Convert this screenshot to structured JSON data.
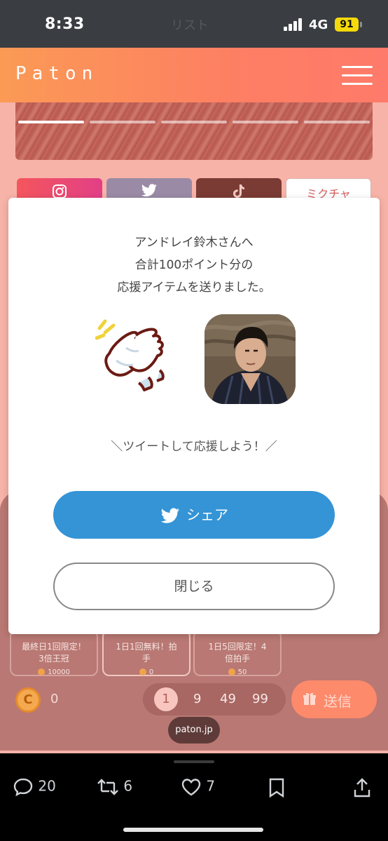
{
  "status_bar": {
    "time": "8:33",
    "ghost_text": "リスト",
    "network": "4G",
    "battery": "91"
  },
  "header": {
    "logo": "Paton",
    "menu_icon": "hamburger-icon"
  },
  "hero": {
    "slides": 5,
    "active_slide": 1
  },
  "social": [
    {
      "name": "instagram",
      "color": "#e8406f"
    },
    {
      "name": "twitter",
      "color": "#9a8aa6"
    },
    {
      "name": "tiktok",
      "color": "#7a3b34"
    },
    {
      "name": "mixchannel",
      "label": "ミクチャ",
      "color": "#ffffff"
    }
  ],
  "modal": {
    "message_line1": "アンドレイ鈴木さんへ",
    "message_line2": "合計100ポイント分の",
    "message_line3": "応援アイテムを送りました。",
    "cta": "＼ツイートして応援しよう！／",
    "share_label": "シェア",
    "close_label": "閉じる"
  },
  "items": [
    {
      "title_line1": "最終日1回限定！",
      "title_line2": "3倍王冠",
      "cost": "10000"
    },
    {
      "title_line1": "1日1回無料！拍",
      "title_line2": "手",
      "cost": "0"
    },
    {
      "title_line1": "1日5回限定！4",
      "title_line2": "倍拍手",
      "cost": "50"
    }
  ],
  "coins": {
    "balance": "0",
    "icon_label": "C"
  },
  "points": {
    "options": [
      "1",
      "9",
      "49",
      "99"
    ],
    "selected": "1"
  },
  "send_label": "送信",
  "url_pill": "paton.jp",
  "tweet_actions": {
    "replies": "20",
    "retweets": "6",
    "likes": "7"
  }
}
